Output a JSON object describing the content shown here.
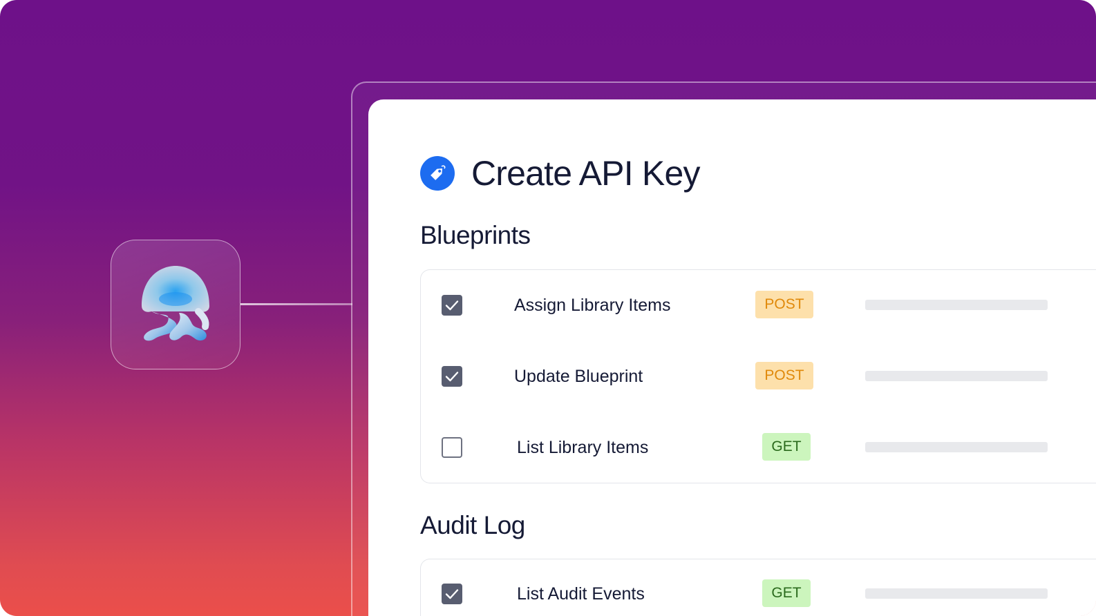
{
  "dialog": {
    "title": "Create API Key"
  },
  "sections": [
    {
      "title": "Blueprints",
      "items": [
        {
          "label": "Assign Library Items",
          "method": "POST",
          "checked": true
        },
        {
          "label": "Update Blueprint",
          "method": "POST",
          "checked": true
        },
        {
          "label": "List Library Items",
          "method": "GET",
          "checked": false
        }
      ]
    },
    {
      "title": "Audit Log",
      "items": [
        {
          "label": "List Audit Events",
          "method": "GET",
          "checked": true
        }
      ]
    }
  ],
  "icons": {
    "app_tile": "jellyfish-logo-icon",
    "title": "tag-icon",
    "checked": "checkmark-icon"
  },
  "colors": {
    "background_top": "#6e1189",
    "background_bottom": "#eb4f4a",
    "title_icon": "#1d6cf0",
    "post_badge_bg": "#fde0ab",
    "post_badge_text": "#e0890a",
    "get_badge_bg": "#ccf5bd",
    "get_badge_text": "#2a6a1c",
    "checkbox_checked": "#585d70"
  }
}
